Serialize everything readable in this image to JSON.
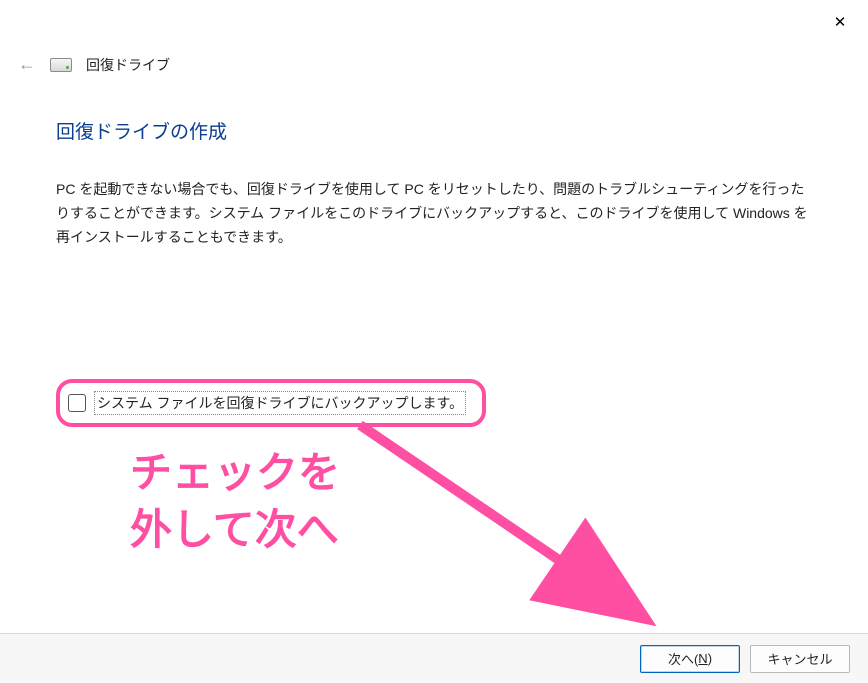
{
  "titlebar": {
    "close_glyph": "✕"
  },
  "header": {
    "back_glyph": "←",
    "window_title": "回復ドライブ"
  },
  "main": {
    "heading": "回復ドライブの作成",
    "description": "PC を起動できない場合でも、回復ドライブを使用して PC をリセットしたり、問題のトラブルシューティングを行ったりすることができます。システム ファイルをこのドライブにバックアップすると、このドライブを使用して Windows を再インストールすることもできます。",
    "checkbox_label": "システム ファイルを回復ドライブにバックアップします。",
    "checkbox_checked": false
  },
  "annotation": {
    "line1": "チェックを",
    "line2": "外して次へ",
    "color": "#ff4fa3"
  },
  "buttons": {
    "next_label_prefix": "次へ(",
    "next_label_key": "N",
    "next_label_suffix": ")",
    "cancel_label": "キャンセル"
  }
}
